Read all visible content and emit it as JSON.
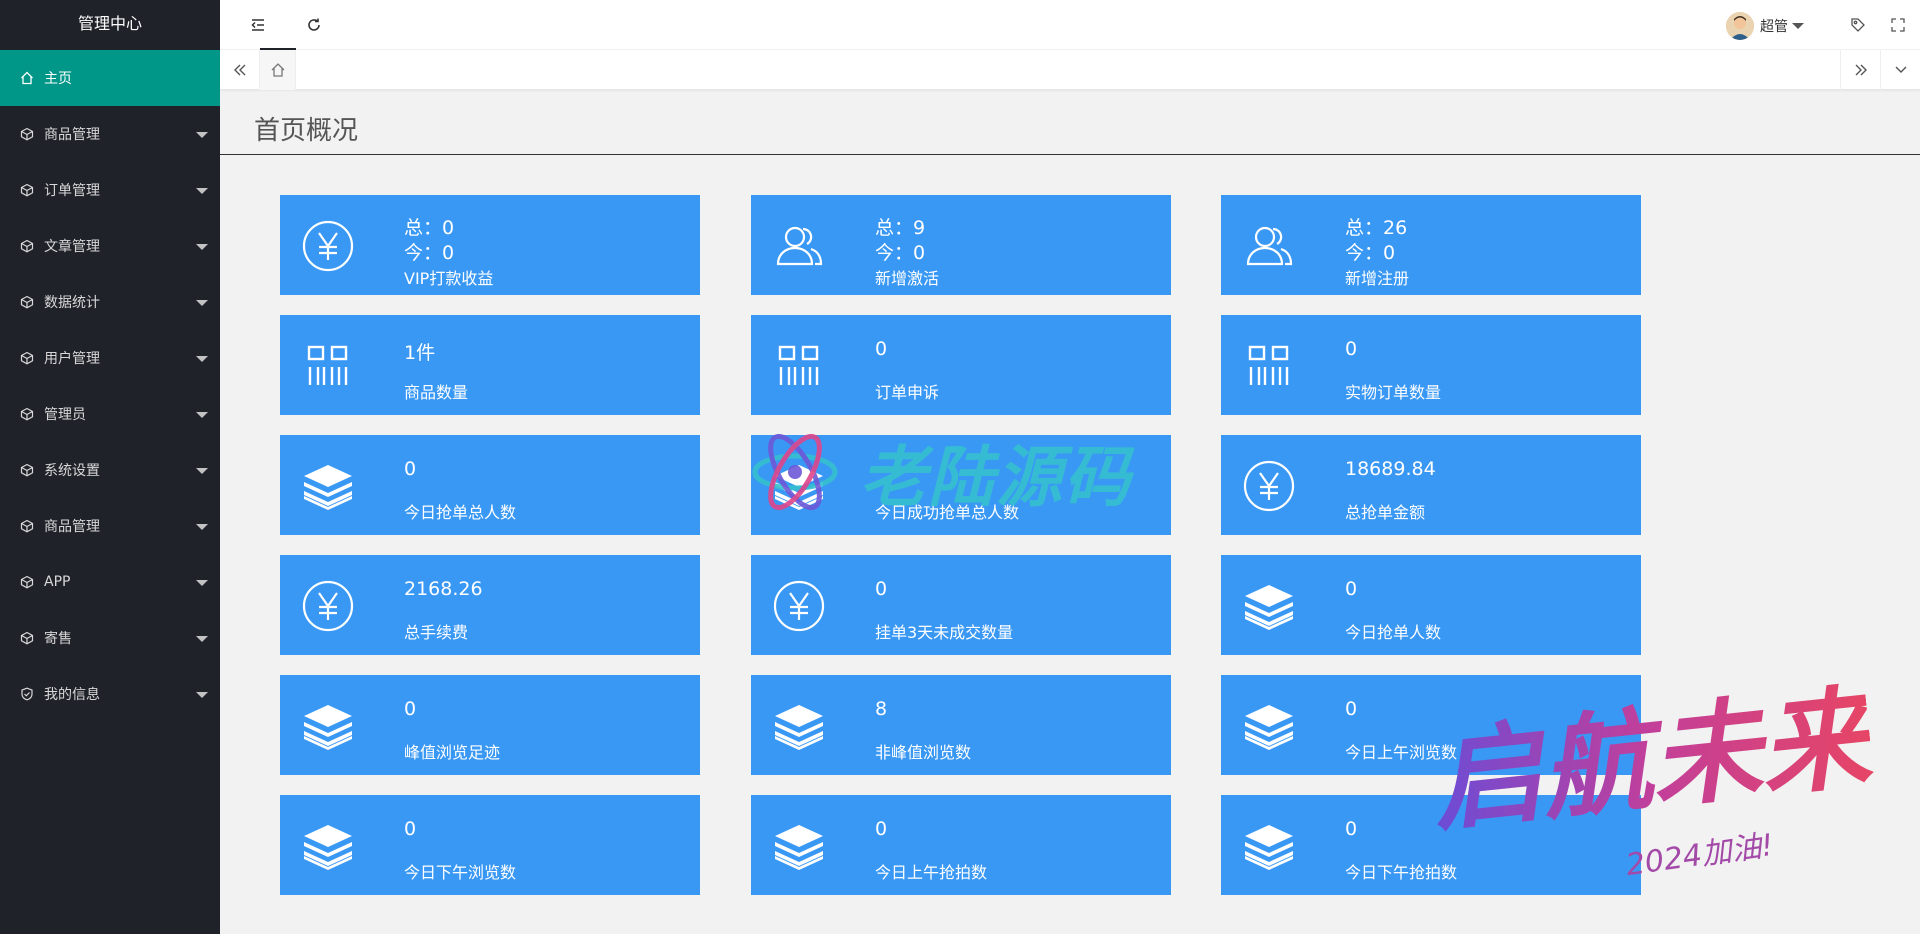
{
  "sidebar": {
    "logo": "管理中心",
    "items": [
      {
        "label": "主页",
        "active": true,
        "icon": "home-icon"
      },
      {
        "label": "商品管理",
        "icon": "cube-icon"
      },
      {
        "label": "订单管理",
        "icon": "cube-icon"
      },
      {
        "label": "文章管理",
        "icon": "cube-icon"
      },
      {
        "label": "数据统计",
        "icon": "cube-icon"
      },
      {
        "label": "用户管理",
        "icon": "cube-icon"
      },
      {
        "label": "管理员",
        "icon": "cube-icon"
      },
      {
        "label": "系统设置",
        "icon": "cube-icon"
      },
      {
        "label": "商品管理",
        "icon": "cube-icon"
      },
      {
        "label": "APP",
        "icon": "cube-icon"
      },
      {
        "label": "寄售",
        "icon": "cube-icon"
      },
      {
        "label": "我的信息",
        "icon": "shield-check-icon"
      }
    ]
  },
  "header": {
    "user_name": "超管"
  },
  "page": {
    "title": "首页概况"
  },
  "cards": [
    {
      "icon": "yen-icon",
      "line1": "总：0",
      "line2": "今：0",
      "label": "VIP打款收益"
    },
    {
      "icon": "users-icon",
      "line1": "总：9",
      "line2": "今：0",
      "label": "新增激活"
    },
    {
      "icon": "users-icon",
      "line1": "总：26",
      "line2": "今：0",
      "label": "新增注册"
    },
    {
      "icon": "barcode-icon",
      "value": "1件",
      "label": "商品数量"
    },
    {
      "icon": "barcode-icon",
      "value": "0",
      "label": "订单申诉"
    },
    {
      "icon": "barcode-icon",
      "value": "0",
      "label": "实物订单数量"
    },
    {
      "icon": "layers-icon",
      "value": "0",
      "label": "今日抢单总人数"
    },
    {
      "icon": "layers-icon",
      "value": "",
      "label": "今日成功抢单总人数"
    },
    {
      "icon": "yen-icon",
      "value": "18689.84",
      "label": "总抢单金额"
    },
    {
      "icon": "yen-icon",
      "value": "2168.26",
      "label": "总手续费"
    },
    {
      "icon": "yen-icon",
      "value": "0",
      "label": "挂单3天未成交数量"
    },
    {
      "icon": "layers-icon",
      "value": "0",
      "label": "今日抢单人数"
    },
    {
      "icon": "layers-icon",
      "value": "0",
      "label": "峰值浏览足迹"
    },
    {
      "icon": "layers-icon",
      "value": "8",
      "label": "非峰值浏览数"
    },
    {
      "icon": "layers-icon",
      "value": "0",
      "label": "今日上午浏览数"
    },
    {
      "icon": "layers-icon",
      "value": "0",
      "label": "今日下午浏览数"
    },
    {
      "icon": "layers-icon",
      "value": "0",
      "label": "今日上午抢拍数"
    },
    {
      "icon": "layers-icon",
      "value": "0",
      "label": "今日下午抢拍数"
    }
  ],
  "watermarks": {
    "center": "老陆源码",
    "bottom": "启航未来",
    "bottom_sub": "2024加油!"
  },
  "colors": {
    "sidebar_bg": "#20222a",
    "active": "#009688",
    "card": "#3a98f5"
  }
}
